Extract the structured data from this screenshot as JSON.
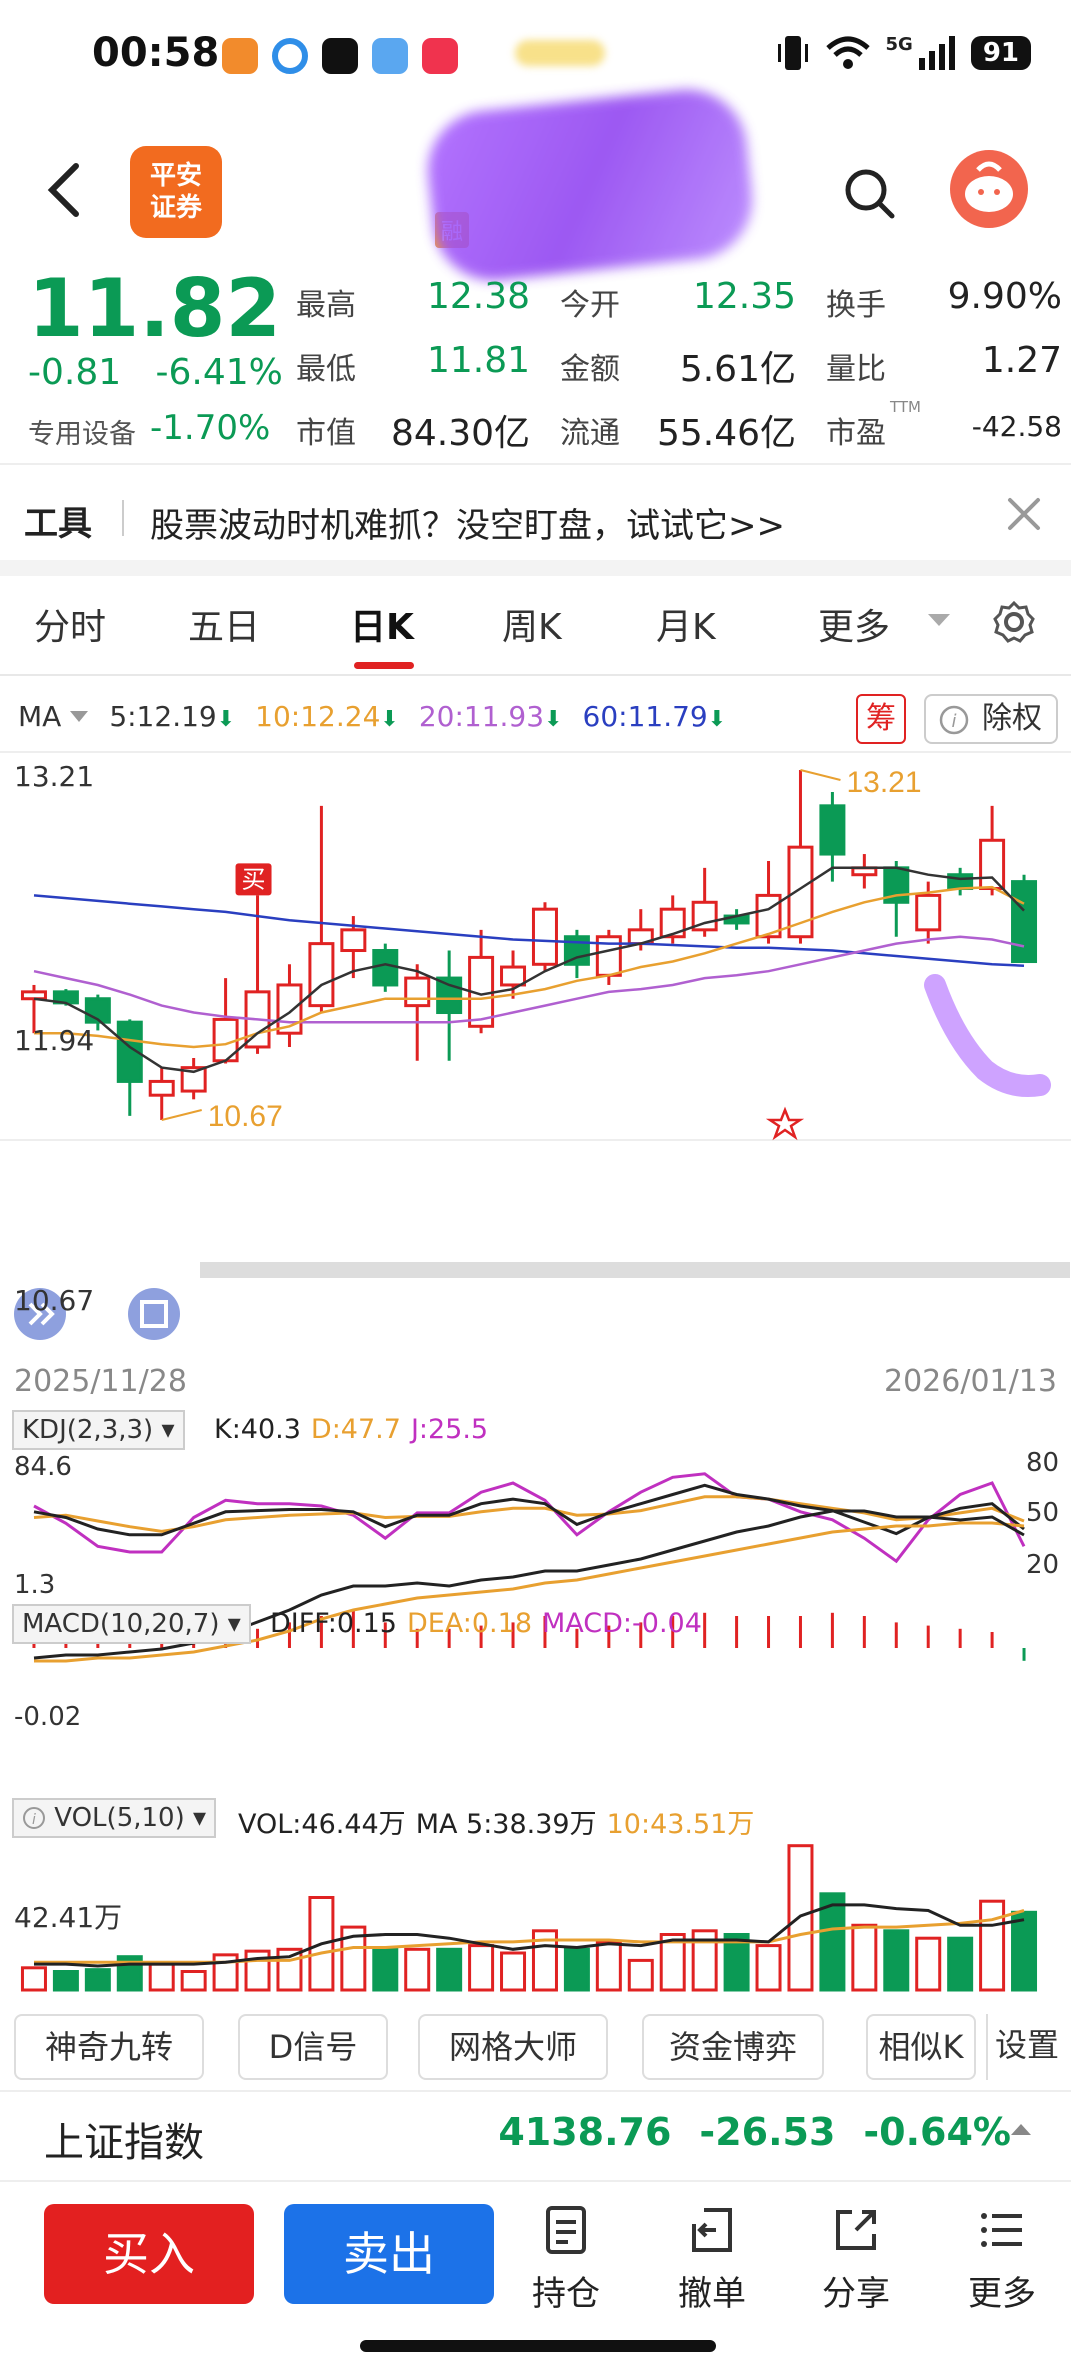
{
  "status": {
    "time": "00:58",
    "network": "5G",
    "battery": "91"
  },
  "header": {
    "logo_text_1": "平安",
    "logo_text_2": "证券",
    "title_tag": "融"
  },
  "quote": {
    "price": "11.82",
    "change": "-0.81",
    "change_pct": "-6.41%",
    "sector": "专用设备",
    "sector_pct": "-1.70%",
    "rows": [
      [
        {
          "label": "最高",
          "value": "12.38",
          "color": "green"
        },
        {
          "label": "今开",
          "value": "12.35",
          "color": "green"
        },
        {
          "label": "换手",
          "value": "9.90%",
          "color": "dark"
        }
      ],
      [
        {
          "label": "最低",
          "value": "11.81",
          "color": "green"
        },
        {
          "label": "金额",
          "value": "5.61亿",
          "color": "dark"
        },
        {
          "label": "量比",
          "value": "1.27",
          "color": "dark"
        }
      ],
      [
        {
          "label": "市值",
          "value": "84.30亿",
          "color": "dark"
        },
        {
          "label": "流通",
          "value": "55.46亿",
          "color": "dark"
        },
        {
          "label": "市盈",
          "value": "-42.58",
          "color": "dark"
        }
      ]
    ],
    "pe_suffix": "TTM"
  },
  "tool_banner": {
    "label": "工具",
    "text": "股票波动时机难抓？没空盯盘，试试它>>"
  },
  "tabs": [
    "分时",
    "五日",
    "日K",
    "周K",
    "月K",
    "更多"
  ],
  "active_tab": "日K",
  "ma": {
    "label": "MA",
    "ma5": "5:12.19",
    "ma10": "10:12.24",
    "ma20": "20:11.93",
    "ma60": "60:11.79",
    "arrow": "⬇"
  },
  "chips": {
    "chou": "筹",
    "fuquan": "除权"
  },
  "kchart": {
    "y_top": "13.21",
    "y_mid": "11.94",
    "y_bottom": "10.67",
    "max_label": "13.21",
    "min_label": "10.67",
    "buy_marker": "买",
    "date_start": "2025/11/28",
    "date_end": "2026/01/13"
  },
  "kdj": {
    "label": "KDJ(2,3,3)",
    "k": "K:40.3",
    "d": "D:47.7",
    "j": "J:25.5",
    "top": "84.6",
    "bottom": "1.3",
    "r80": "80",
    "r50": "50",
    "r20": "20"
  },
  "macd": {
    "label": "MACD(10,20,7)",
    "diff": "DIFF:0.15",
    "dea": "DEA:0.18",
    "macd": "MACD:-0.04",
    "axis": "-0.02"
  },
  "vol": {
    "label": "VOL(5,10)",
    "vol": "VOL:46.44万",
    "ma5": "MA 5:38.39万",
    "ma10": "10:43.51万",
    "axis": "42.41万"
  },
  "tool_chips": [
    "神奇九转",
    "D信号",
    "网格大师",
    "资金博弈",
    "相似K",
    "设置"
  ],
  "index": {
    "name": "上证指数",
    "value": "4138.76",
    "change": "-26.53",
    "pct": "-0.64%"
  },
  "actions": {
    "buy": "买入",
    "sell": "卖出",
    "position": "持仓",
    "cancel": "撤单",
    "share": "分享",
    "more": "更多"
  },
  "colors": {
    "up": "#e02222",
    "down": "#0b9a55",
    "ma5": "#333333",
    "ma10": "#e8a030",
    "ma20": "#b060d0",
    "ma60": "#2a3fc0"
  },
  "chart_data": {
    "type": "candlestick",
    "x_range": [
      "2025/11/28",
      "2026/01/13"
    ],
    "ylim": [
      10.67,
      13.21
    ],
    "candles": [
      {
        "o": 11.6,
        "c": 11.55,
        "h": 11.65,
        "l": 11.3,
        "up": true
      },
      {
        "o": 11.6,
        "c": 11.52,
        "h": 11.62,
        "l": 11.5,
        "up": false
      },
      {
        "o": 11.55,
        "c": 11.38,
        "h": 11.58,
        "l": 11.32,
        "up": false
      },
      {
        "o": 11.38,
        "c": 10.95,
        "h": 11.4,
        "l": 10.7,
        "up": false
      },
      {
        "o": 10.85,
        "c": 10.95,
        "h": 11.05,
        "l": 10.67,
        "up": true
      },
      {
        "o": 10.88,
        "c": 11.05,
        "h": 11.12,
        "l": 10.82,
        "up": true
      },
      {
        "o": 11.1,
        "c": 11.4,
        "h": 11.7,
        "l": 11.08,
        "up": true
      },
      {
        "o": 11.2,
        "c": 11.6,
        "h": 12.3,
        "l": 11.15,
        "up": true
      },
      {
        "o": 11.3,
        "c": 11.65,
        "h": 11.8,
        "l": 11.2,
        "up": true
      },
      {
        "o": 11.5,
        "c": 11.95,
        "h": 12.95,
        "l": 11.45,
        "up": true
      },
      {
        "o": 11.9,
        "c": 12.05,
        "h": 12.15,
        "l": 11.7,
        "up": true
      },
      {
        "o": 11.9,
        "c": 11.65,
        "h": 11.95,
        "l": 11.6,
        "up": false
      },
      {
        "o": 11.5,
        "c": 11.7,
        "h": 11.8,
        "l": 11.1,
        "up": true
      },
      {
        "o": 11.7,
        "c": 11.45,
        "h": 11.9,
        "l": 11.1,
        "up": false
      },
      {
        "o": 11.35,
        "c": 11.85,
        "h": 12.05,
        "l": 11.3,
        "up": true
      },
      {
        "o": 11.65,
        "c": 11.78,
        "h": 11.9,
        "l": 11.55,
        "up": true
      },
      {
        "o": 11.8,
        "c": 12.2,
        "h": 12.25,
        "l": 11.75,
        "up": true
      },
      {
        "o": 12.0,
        "c": 11.8,
        "h": 12.05,
        "l": 11.7,
        "up": false
      },
      {
        "o": 11.72,
        "c": 12.0,
        "h": 12.05,
        "l": 11.65,
        "up": true
      },
      {
        "o": 11.95,
        "c": 12.05,
        "h": 12.2,
        "l": 11.9,
        "up": true
      },
      {
        "o": 12.0,
        "c": 12.2,
        "h": 12.3,
        "l": 11.95,
        "up": true
      },
      {
        "o": 12.05,
        "c": 12.25,
        "h": 12.5,
        "l": 12.0,
        "up": true
      },
      {
        "o": 12.15,
        "c": 12.1,
        "h": 12.2,
        "l": 12.05,
        "up": false
      },
      {
        "o": 12.0,
        "c": 12.3,
        "h": 12.55,
        "l": 11.95,
        "up": true
      },
      {
        "o": 12.0,
        "c": 12.65,
        "h": 13.21,
        "l": 11.95,
        "up": true
      },
      {
        "o": 12.95,
        "c": 12.6,
        "h": 13.05,
        "l": 12.4,
        "up": false
      },
      {
        "o": 12.45,
        "c": 12.5,
        "h": 12.6,
        "l": 12.35,
        "up": true
      },
      {
        "o": 12.5,
        "c": 12.25,
        "h": 12.55,
        "l": 12.0,
        "up": false
      },
      {
        "o": 12.05,
        "c": 12.3,
        "h": 12.4,
        "l": 11.95,
        "up": true
      },
      {
        "o": 12.45,
        "c": 12.35,
        "h": 12.5,
        "l": 12.3,
        "up": false
      },
      {
        "o": 12.35,
        "c": 12.7,
        "h": 12.95,
        "l": 12.3,
        "up": true
      },
      {
        "o": 12.4,
        "c": 11.82,
        "h": 12.45,
        "l": 11.81,
        "up": false
      }
    ],
    "ma5": [
      11.55,
      11.52,
      11.4,
      11.2,
      11.05,
      11.02,
      11.1,
      11.3,
      11.45,
      11.65,
      11.75,
      11.8,
      11.75,
      11.65,
      11.58,
      11.62,
      11.75,
      11.85,
      11.9,
      11.95,
      12.02,
      12.1,
      12.15,
      12.2,
      12.35,
      12.5,
      12.5,
      12.5,
      12.45,
      12.42,
      12.43,
      12.19
    ],
    "ma10": [
      11.3,
      11.3,
      11.28,
      11.25,
      11.22,
      11.2,
      11.22,
      11.3,
      11.35,
      11.45,
      11.5,
      11.55,
      11.55,
      11.55,
      11.55,
      11.58,
      11.62,
      11.68,
      11.72,
      11.78,
      11.82,
      11.88,
      11.95,
      12.02,
      12.1,
      12.18,
      12.25,
      12.3,
      12.32,
      12.35,
      12.36,
      12.24
    ],
    "ma20": [
      11.75,
      11.7,
      11.65,
      11.58,
      11.5,
      11.45,
      11.42,
      11.4,
      11.38,
      11.38,
      11.38,
      11.38,
      11.38,
      11.38,
      11.4,
      11.45,
      11.5,
      11.55,
      11.6,
      11.62,
      11.65,
      11.7,
      11.72,
      11.75,
      11.8,
      11.85,
      11.9,
      11.95,
      11.98,
      12.0,
      11.98,
      11.93
    ],
    "ma60": [
      12.3,
      12.28,
      12.26,
      12.24,
      12.22,
      12.2,
      12.18,
      12.15,
      12.12,
      12.1,
      12.08,
      12.06,
      12.04,
      12.02,
      12.0,
      11.98,
      11.97,
      11.96,
      11.95,
      11.95,
      11.94,
      11.93,
      11.92,
      11.92,
      11.91,
      11.9,
      11.88,
      11.86,
      11.84,
      11.82,
      11.8,
      11.79
    ],
    "kdj_k": [
      55,
      50,
      40,
      35,
      35,
      45,
      55,
      56,
      57,
      57,
      55,
      42,
      52,
      52,
      62,
      66,
      62,
      44,
      54,
      62,
      70,
      78,
      70,
      66,
      60,
      56,
      46,
      36,
      50,
      58,
      62,
      40
    ],
    "kdj_d": [
      50,
      52,
      47,
      42,
      38,
      42,
      48,
      50,
      52,
      53,
      54,
      50,
      51,
      51,
      55,
      58,
      58,
      52,
      53,
      56,
      62,
      68,
      68,
      66,
      62,
      58,
      54,
      48,
      50,
      54,
      58,
      47
    ],
    "kdj_j": [
      60,
      45,
      25,
      20,
      20,
      50,
      65,
      62,
      62,
      60,
      52,
      32,
      54,
      54,
      72,
      80,
      65,
      35,
      55,
      72,
      85,
      88,
      68,
      66,
      55,
      48,
      32,
      12,
      48,
      70,
      80,
      25
    ],
    "macd_hist": [
      0.02,
      0.03,
      0.02,
      0.02,
      0.02,
      0.02,
      0.04,
      0.06,
      0.08,
      0.1,
      0.12,
      0.08,
      0.06,
      0.06,
      0.07,
      0.08,
      0.1,
      0.06,
      0.07,
      0.08,
      0.1,
      0.11,
      0.1,
      0.1,
      0.1,
      0.11,
      0.1,
      0.08,
      0.07,
      0.06,
      0.05,
      -0.04
    ],
    "macd_diff": [
      -0.26,
      -0.25,
      -0.25,
      -0.24,
      -0.23,
      -0.21,
      -0.18,
      -0.14,
      -0.1,
      -0.05,
      -0.02,
      -0.02,
      -0.01,
      -0.02,
      0.0,
      0.01,
      0.03,
      0.03,
      0.05,
      0.07,
      0.1,
      0.13,
      0.16,
      0.18,
      0.21,
      0.23,
      0.23,
      0.21,
      0.21,
      0.2,
      0.21,
      0.15
    ],
    "macd_dea": [
      -0.27,
      -0.27,
      -0.26,
      -0.26,
      -0.25,
      -0.24,
      -0.22,
      -0.2,
      -0.17,
      -0.13,
      -0.1,
      -0.08,
      -0.06,
      -0.05,
      -0.04,
      -0.03,
      -0.01,
      0.0,
      0.02,
      0.04,
      0.06,
      0.08,
      0.1,
      0.12,
      0.14,
      0.16,
      0.17,
      0.18,
      0.18,
      0.19,
      0.19,
      0.18
    ],
    "vol": [
      12,
      10,
      11,
      18,
      14,
      10,
      19,
      21,
      22,
      50,
      34,
      22,
      22,
      22,
      24,
      20,
      32,
      22,
      26,
      16,
      30,
      32,
      30,
      24,
      78,
      52,
      35,
      32,
      28,
      28,
      48,
      42
    ],
    "vol_ma5": [
      14,
      14,
      13,
      14,
      14,
      14,
      15,
      17,
      18,
      25,
      29,
      30,
      30,
      28,
      25,
      22,
      24,
      23,
      25,
      24,
      27,
      27,
      27,
      26,
      40,
      46,
      46,
      44,
      43,
      35,
      35,
      38
    ],
    "vol_ma10": [
      15,
      15,
      15,
      15,
      15,
      15,
      15,
      16,
      16,
      20,
      23,
      23,
      24,
      25,
      26,
      26,
      27,
      27,
      27,
      26,
      26,
      26,
      26,
      26,
      30,
      33,
      34,
      34,
      35,
      36,
      38,
      43
    ]
  }
}
